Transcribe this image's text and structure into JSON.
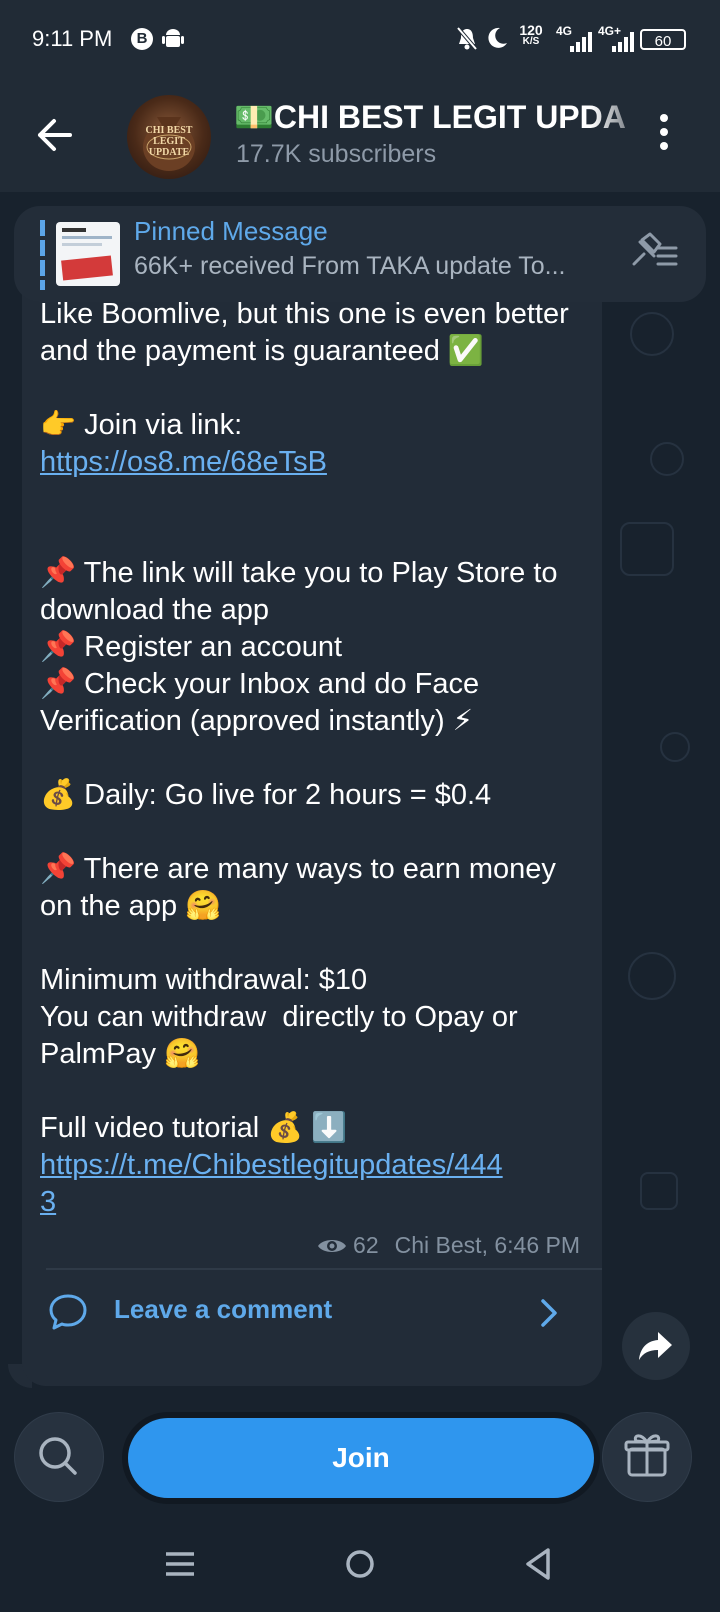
{
  "status_bar": {
    "time": "9:11 PM",
    "net_speed_value": "120",
    "net_speed_unit": "K/S",
    "network_1": "4G",
    "network_2": "4G+",
    "battery": "60"
  },
  "header": {
    "title": "💵CHI BEST LEGIT UPDA",
    "subscribers": "17.7K subscribers",
    "avatar_text": "CHI BEST LEGIT UPDATE"
  },
  "pinned": {
    "title": "Pinned Message",
    "preview": "66K+ received From TAKA update To..."
  },
  "message": {
    "text_intro": "Like Boomlive, but this one is even better and the payment is guaranteed ✅\n\n👉 Join via link:",
    "link1": "https://os8.me/68eTsB",
    "text_body": "\n\n📌 The link will take you to Play Store to download the app\n📌 Register an account\n📌 Check your Inbox and do Face Verification (approved instantly) ⚡\n\n💰 Daily: Go live for 2 hours = $0.4\n\n📌 There are many ways to earn money on the app 🤗\n\nMinimum withdrawal: $10\nYou can withdraw  directly to Opay or PalmPay 🤗\n\nFull video tutorial 💰 ⬇️",
    "link2": "https://t.me/Chibestlegitupdates/4443",
    "views": "62",
    "author_time": "Chi Best, 6:46 PM"
  },
  "comments": {
    "label": "Leave a comment"
  },
  "bottom": {
    "join_label": "Join"
  },
  "colors": {
    "accent": "#2f96ee",
    "link": "#6ab0f0",
    "background": "#18222d",
    "bubble": "#222c38"
  },
  "icons": {
    "back": "arrow-left-icon",
    "more": "more-vertical-icon",
    "pin_list": "pin-list-icon",
    "eye": "eye-icon",
    "comment": "chat-bubble-icon",
    "chevron": "chevron-right-icon",
    "share": "share-arrow-icon",
    "search": "search-icon",
    "gift": "gift-icon"
  }
}
